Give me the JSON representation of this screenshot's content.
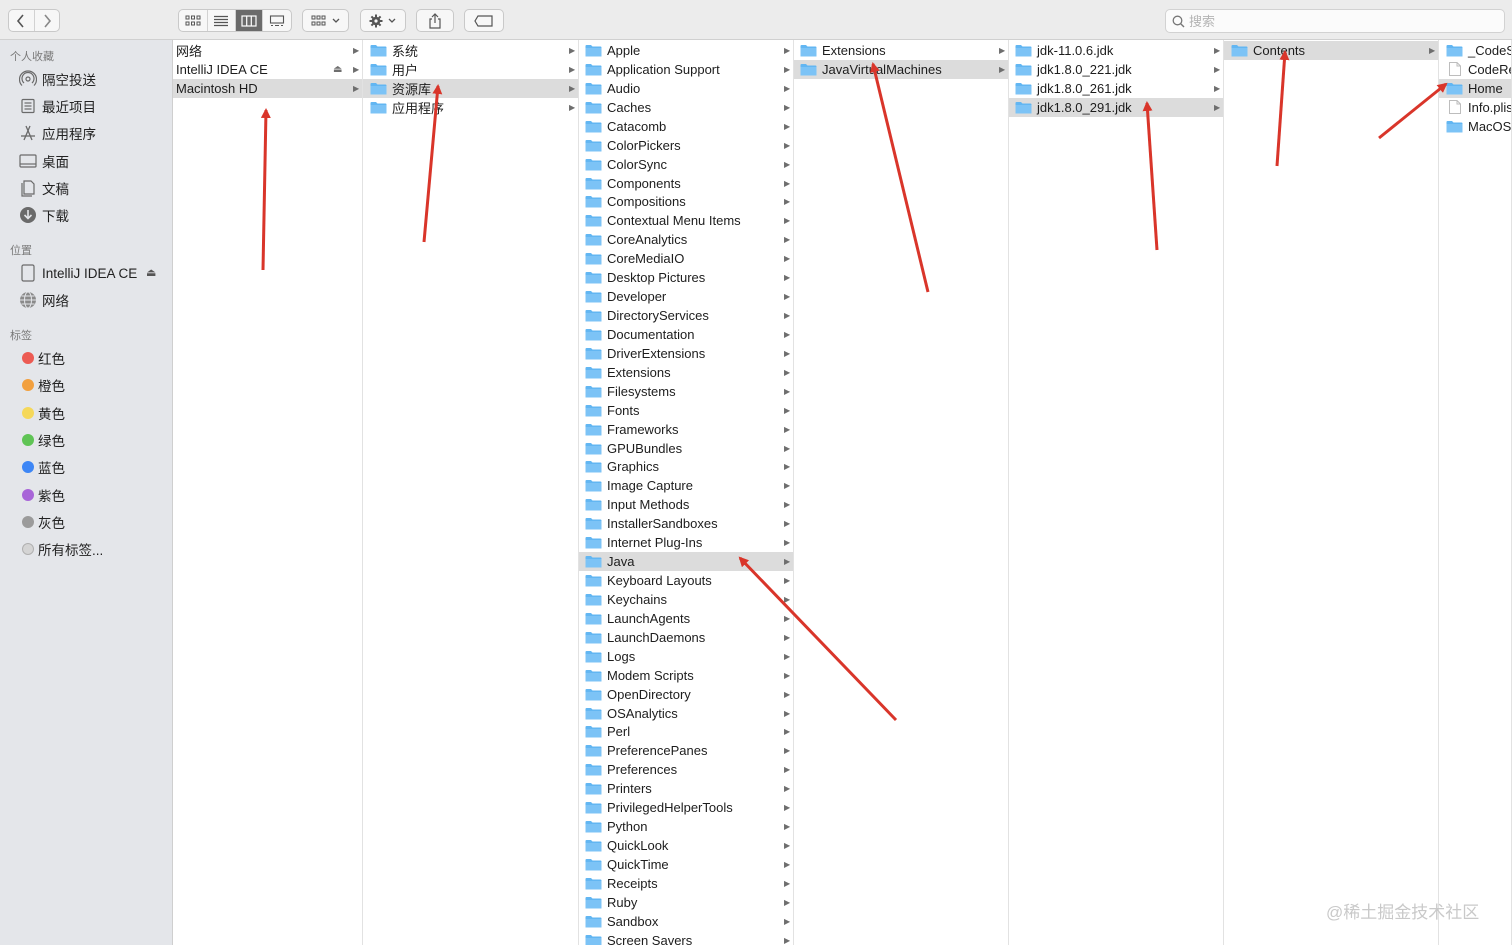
{
  "toolbar": {
    "view_buttons": [
      "icon-view",
      "list-view",
      "column-view",
      "gallery-view"
    ],
    "active_view": "column-view",
    "search_placeholder": "搜索"
  },
  "sidebar": {
    "favorites_title": "个人收藏",
    "favorites": [
      {
        "label": "隔空投送",
        "icon": "airdrop-icon"
      },
      {
        "label": "最近项目",
        "icon": "recents-icon"
      },
      {
        "label": "应用程序",
        "icon": "applications-icon"
      },
      {
        "label": "桌面",
        "icon": "desktop-icon"
      },
      {
        "label": "文稿",
        "icon": "documents-icon"
      },
      {
        "label": "下载",
        "icon": "downloads-icon"
      }
    ],
    "locations_title": "位置",
    "locations": [
      {
        "label": "IntelliJ IDEA CE",
        "icon": "disk-icon",
        "eject": "⏏"
      },
      {
        "label": "网络",
        "icon": "network-icon"
      }
    ],
    "tags_title": "标签",
    "tags": [
      {
        "label": "红色",
        "color": "#ec5b53"
      },
      {
        "label": "橙色",
        "color": "#f2a03f"
      },
      {
        "label": "黄色",
        "color": "#f5d85a"
      },
      {
        "label": "绿色",
        "color": "#5fc455"
      },
      {
        "label": "蓝色",
        "color": "#3d86f5"
      },
      {
        "label": "紫色",
        "color": "#a865d8"
      },
      {
        "label": "灰色",
        "color": "#9b9b9b"
      },
      {
        "label": "所有标签...",
        "color": "#d4d4d4"
      }
    ]
  },
  "columns": [
    {
      "items": [
        {
          "name": "网络",
          "type": "none"
        },
        {
          "name": "IntelliJ IDEA CE",
          "type": "none",
          "eject": "⏏"
        },
        {
          "name": "Macintosh HD",
          "type": "none",
          "selected": true
        }
      ]
    },
    {
      "items": [
        {
          "name": "系统",
          "type": "folder"
        },
        {
          "name": "用户",
          "type": "folder"
        },
        {
          "name": "资源库",
          "type": "folder",
          "selected": true
        },
        {
          "name": "应用程序",
          "type": "folder"
        }
      ]
    },
    {
      "items": [
        {
          "name": "Apple",
          "type": "folder"
        },
        {
          "name": "Application Support",
          "type": "folder"
        },
        {
          "name": "Audio",
          "type": "folder"
        },
        {
          "name": "Caches",
          "type": "folder"
        },
        {
          "name": "Catacomb",
          "type": "folder"
        },
        {
          "name": "ColorPickers",
          "type": "folder"
        },
        {
          "name": "ColorSync",
          "type": "folder"
        },
        {
          "name": "Components",
          "type": "folder"
        },
        {
          "name": "Compositions",
          "type": "folder"
        },
        {
          "name": "Contextual Menu Items",
          "type": "folder"
        },
        {
          "name": "CoreAnalytics",
          "type": "folder"
        },
        {
          "name": "CoreMediaIO",
          "type": "folder"
        },
        {
          "name": "Desktop Pictures",
          "type": "folder"
        },
        {
          "name": "Developer",
          "type": "folder"
        },
        {
          "name": "DirectoryServices",
          "type": "folder"
        },
        {
          "name": "Documentation",
          "type": "folder"
        },
        {
          "name": "DriverExtensions",
          "type": "folder"
        },
        {
          "name": "Extensions",
          "type": "folder"
        },
        {
          "name": "Filesystems",
          "type": "folder"
        },
        {
          "name": "Fonts",
          "type": "folder"
        },
        {
          "name": "Frameworks",
          "type": "folder"
        },
        {
          "name": "GPUBundles",
          "type": "folder"
        },
        {
          "name": "Graphics",
          "type": "folder"
        },
        {
          "name": "Image Capture",
          "type": "folder"
        },
        {
          "name": "Input Methods",
          "type": "folder"
        },
        {
          "name": "InstallerSandboxes",
          "type": "folder"
        },
        {
          "name": "Internet Plug-Ins",
          "type": "folder"
        },
        {
          "name": "Java",
          "type": "folder",
          "selected": true
        },
        {
          "name": "Keyboard Layouts",
          "type": "folder"
        },
        {
          "name": "Keychains",
          "type": "folder"
        },
        {
          "name": "LaunchAgents",
          "type": "folder"
        },
        {
          "name": "LaunchDaemons",
          "type": "folder"
        },
        {
          "name": "Logs",
          "type": "folder"
        },
        {
          "name": "Modem Scripts",
          "type": "folder"
        },
        {
          "name": "OpenDirectory",
          "type": "folder"
        },
        {
          "name": "OSAnalytics",
          "type": "folder"
        },
        {
          "name": "Perl",
          "type": "folder"
        },
        {
          "name": "PreferencePanes",
          "type": "folder"
        },
        {
          "name": "Preferences",
          "type": "folder"
        },
        {
          "name": "Printers",
          "type": "folder"
        },
        {
          "name": "PrivilegedHelperTools",
          "type": "folder"
        },
        {
          "name": "Python",
          "type": "folder"
        },
        {
          "name": "QuickLook",
          "type": "folder"
        },
        {
          "name": "QuickTime",
          "type": "folder"
        },
        {
          "name": "Receipts",
          "type": "folder"
        },
        {
          "name": "Ruby",
          "type": "folder"
        },
        {
          "name": "Sandbox",
          "type": "folder"
        },
        {
          "name": "Screen Savers",
          "type": "folder"
        }
      ]
    },
    {
      "items": [
        {
          "name": "Extensions",
          "type": "folder"
        },
        {
          "name": "JavaVirtualMachines",
          "type": "folder",
          "selected": true
        }
      ]
    },
    {
      "items": [
        {
          "name": "jdk-11.0.6.jdk",
          "type": "folder"
        },
        {
          "name": "jdk1.8.0_221.jdk",
          "type": "folder"
        },
        {
          "name": "jdk1.8.0_261.jdk",
          "type": "folder"
        },
        {
          "name": "jdk1.8.0_291.jdk",
          "type": "folder",
          "selected": true
        }
      ]
    },
    {
      "items": [
        {
          "name": "Contents",
          "type": "folder",
          "selected": true
        }
      ]
    },
    {
      "items": [
        {
          "name": "_CodeS",
          "type": "folder"
        },
        {
          "name": "CodeRe",
          "type": "file"
        },
        {
          "name": "Home",
          "type": "folder",
          "selected": true
        },
        {
          "name": "Info.plis",
          "type": "file"
        },
        {
          "name": "MacOS",
          "type": "folder"
        }
      ]
    }
  ],
  "watermark": "@稀土掘金技术社区",
  "colors": {
    "arrow": "#d9352a",
    "folder": "#62b6f2",
    "selection": "#dcdcdc"
  }
}
